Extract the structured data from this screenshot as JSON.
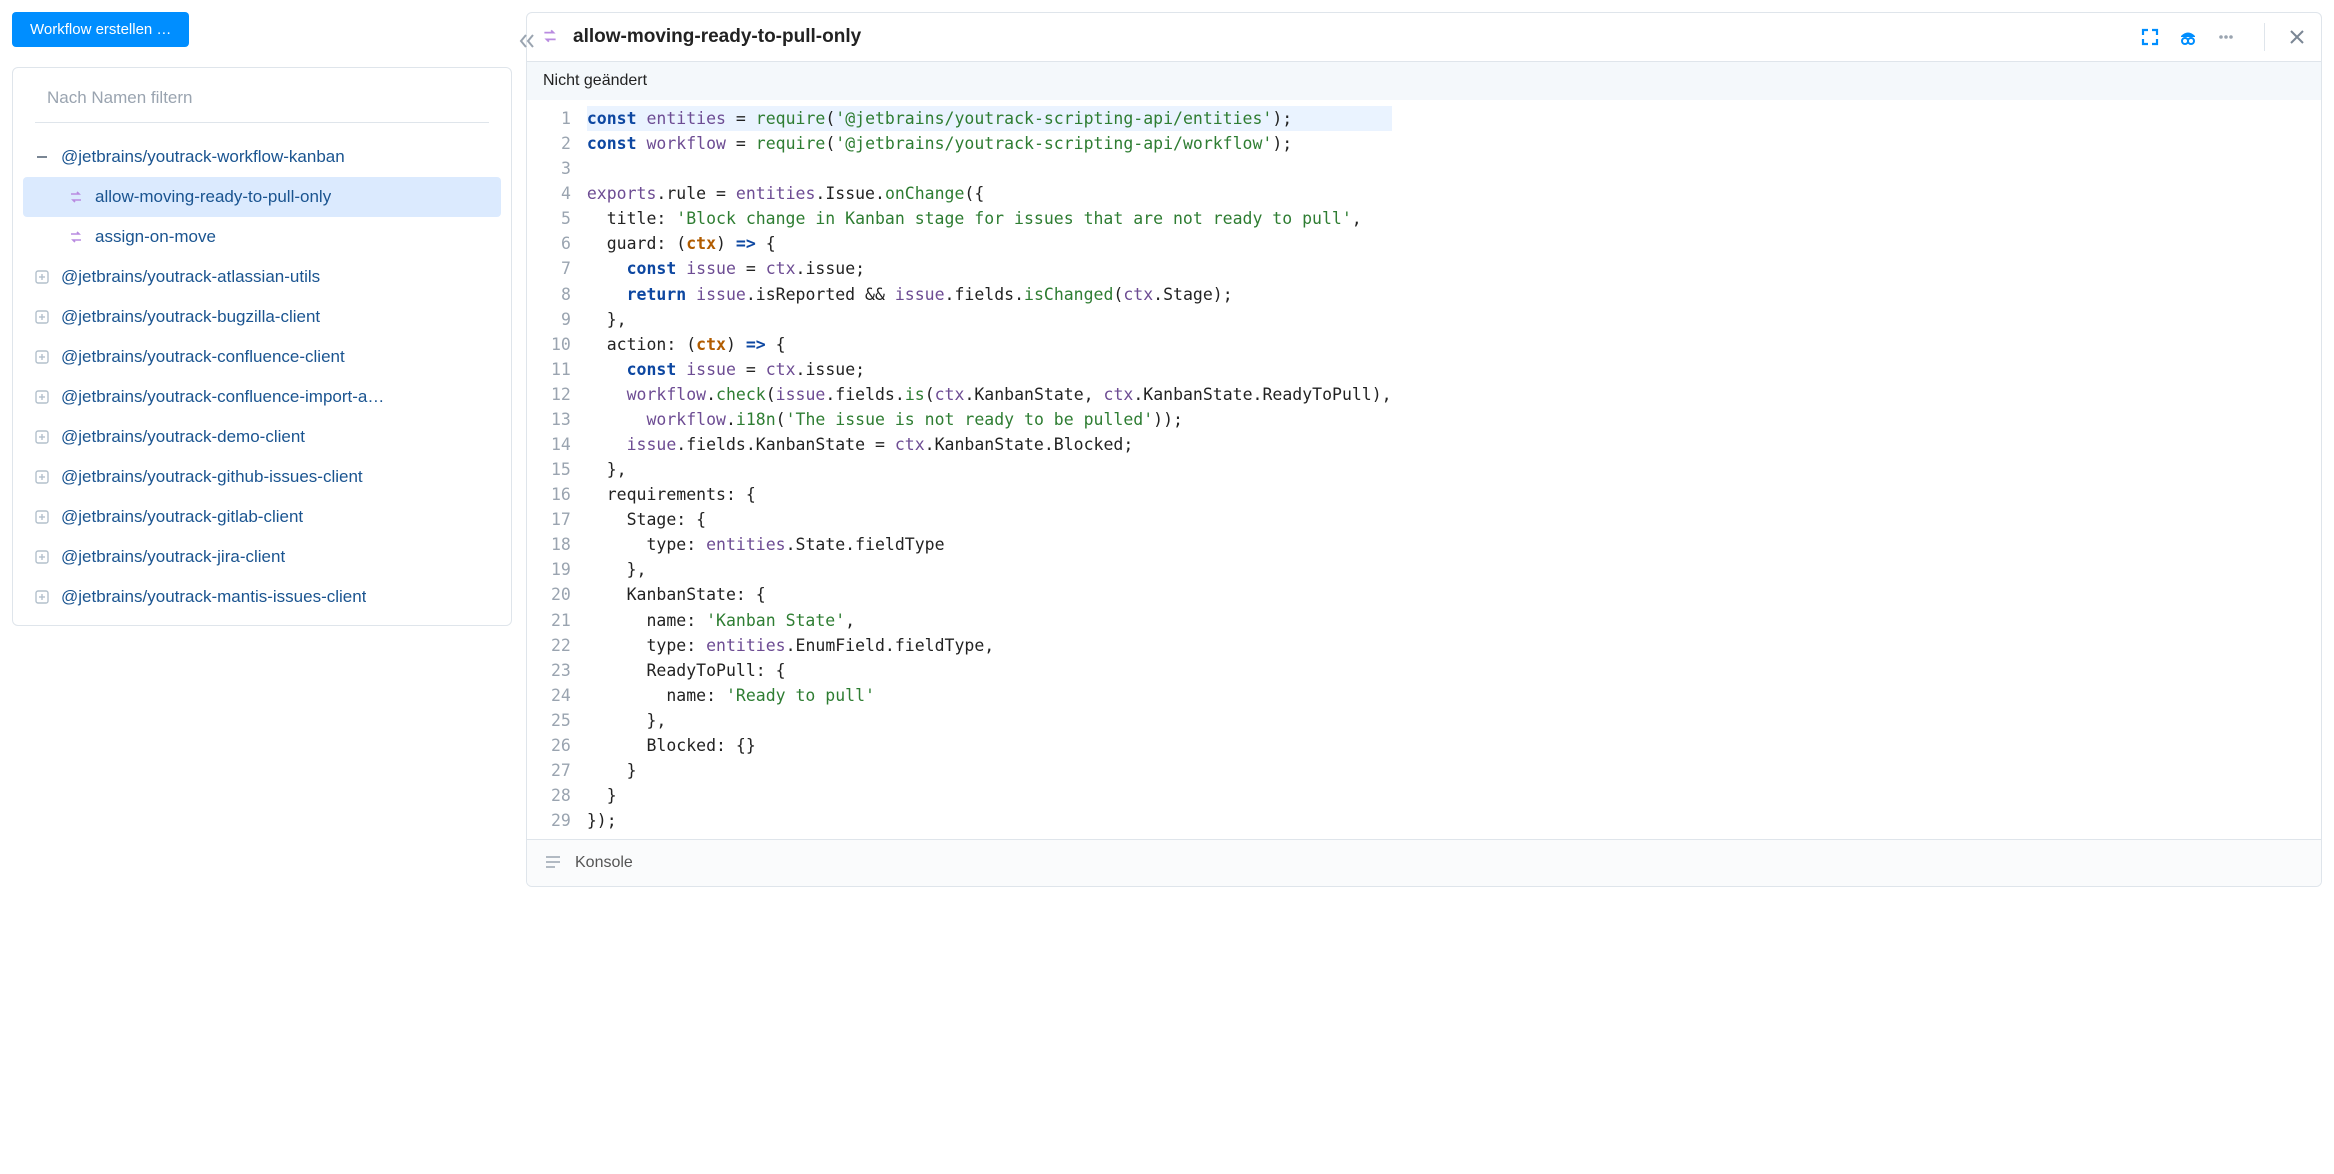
{
  "toolbar": {
    "create_label": "Workflow erstellen …"
  },
  "filter": {
    "placeholder": "Nach Namen filtern"
  },
  "tree": {
    "expanded": {
      "name": "@jetbrains/youtrack-workflow-kanban",
      "children": [
        {
          "name": "allow-moving-ready-to-pull-only",
          "selected": true
        },
        {
          "name": "assign-on-move",
          "selected": false
        }
      ]
    },
    "collapsed": [
      "@jetbrains/youtrack-atlassian-utils",
      "@jetbrains/youtrack-bugzilla-client",
      "@jetbrains/youtrack-confluence-client",
      "@jetbrains/youtrack-confluence-import-a…",
      "@jetbrains/youtrack-demo-client",
      "@jetbrains/youtrack-github-issues-client",
      "@jetbrains/youtrack-gitlab-client",
      "@jetbrains/youtrack-jira-client",
      "@jetbrains/youtrack-mantis-issues-client"
    ]
  },
  "editor": {
    "title": "allow-moving-ready-to-pull-only",
    "status": "Nicht geändert",
    "console_label": "Konsole"
  },
  "code": {
    "line_count": 29,
    "strings": {
      "entities_mod": "'@jetbrains/youtrack-scripting-api/entities'",
      "workflow_mod": "'@jetbrains/youtrack-scripting-api/workflow'",
      "title_str": "'Block change in Kanban stage for issues that are not ready to pull'",
      "check_str": "'The issue is not ready to be pulled'",
      "kanban_state": "'Kanban State'",
      "ready_to_pull": "'Ready to pull'"
    }
  }
}
